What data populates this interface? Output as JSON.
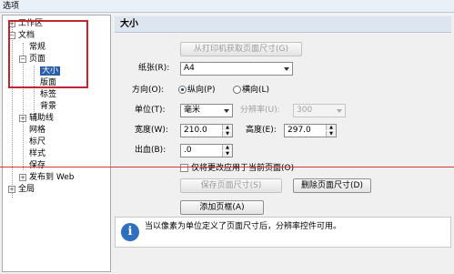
{
  "window": {
    "title": "选项"
  },
  "tree": {
    "items": [
      {
        "label": "工作区",
        "toggle": "+"
      },
      {
        "label": "文档",
        "toggle": "−"
      },
      {
        "label": "常规"
      },
      {
        "label": "页面",
        "toggle": "−"
      },
      {
        "label": "大小",
        "selected": true
      },
      {
        "label": "版面"
      },
      {
        "label": "标签"
      },
      {
        "label": "背景"
      },
      {
        "label": "辅助线",
        "toggle": "+"
      },
      {
        "label": "网格"
      },
      {
        "label": "标尺"
      },
      {
        "label": "样式"
      },
      {
        "label": "保存"
      },
      {
        "label": "发布到 Web",
        "toggle": "+"
      },
      {
        "label": "全局",
        "toggle": "+"
      }
    ]
  },
  "panel": {
    "title": "大小",
    "get_from_printer_button": "从打印机获取页面尺寸(G)",
    "paper_label": "纸张(R):",
    "paper_value": "A4",
    "orientation_label": "方向(O):",
    "portrait_label": "纵向(P)",
    "landscape_label": "横向(L)",
    "portrait_selected": true,
    "unit_label": "单位(T):",
    "unit_value": "毫米",
    "resolution_label": "分辨率(U):",
    "resolution_value": "300",
    "width_label": "宽度(W):",
    "width_value": "210.0",
    "height_label": "高度(E):",
    "height_value": "297.0",
    "bleed_label": "出血(B):",
    "bleed_value": ".0",
    "only_current_page_label": "仅将更改应用于当前页面(O)",
    "only_current_page_checked": false,
    "save_page_size_button": "保存页面尺寸(S)",
    "delete_page_size_button": "删除页面尺寸(D)",
    "add_page_frame_button": "添加页框(A)",
    "info_text": "当以像素为单位定义了页面尺寸后，分辨率控件可用。"
  },
  "colors": {
    "selection": "#2a5ea8",
    "highlight_box": "#c0262d",
    "info_icon": "#2f6fbf"
  }
}
